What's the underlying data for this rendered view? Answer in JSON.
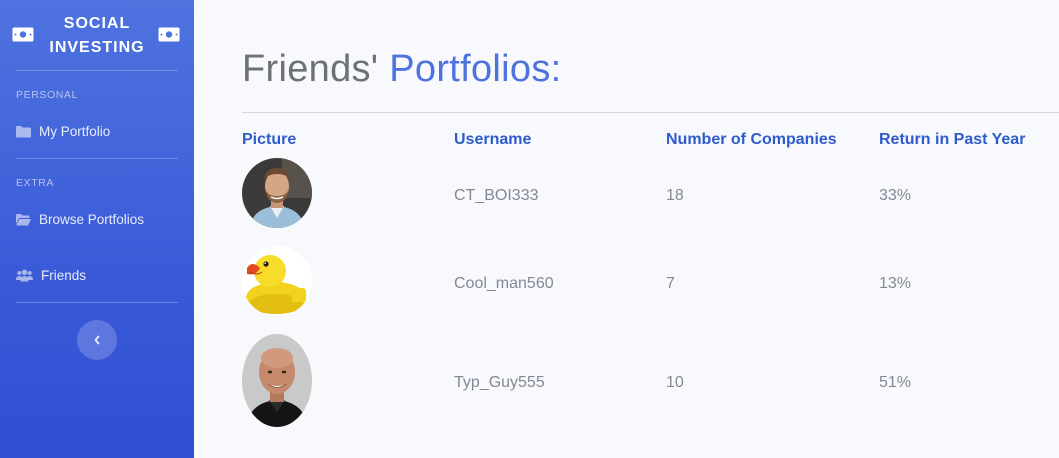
{
  "brand": {
    "title": "SOCIAL INVESTING",
    "icon": "money-bill-icon"
  },
  "sidebar": {
    "sections": [
      {
        "heading": "PERSONAL",
        "items": [
          {
            "label": "My Portfolio",
            "icon": "folder-icon"
          }
        ]
      },
      {
        "heading": "EXTRA",
        "items": [
          {
            "label": "Browse Portfolios",
            "icon": "folder-open-icon"
          },
          {
            "label": "Friends",
            "icon": "users-icon"
          }
        ]
      }
    ],
    "toggle_icon": "chevron-left-icon"
  },
  "page": {
    "title_plain": "Friends'",
    "title_accent": "Portfolios:"
  },
  "table": {
    "headers": [
      "Picture",
      "Username",
      "Number of Companies",
      "Return in Past Year"
    ],
    "rows": [
      {
        "picture": "bearded-man-avatar",
        "username": "CT_BOI333",
        "companies": "18",
        "return": "33%"
      },
      {
        "picture": "rubber-duck-avatar",
        "username": "Cool_man560",
        "companies": "7",
        "return": "13%"
      },
      {
        "picture": "bald-man-avatar",
        "username": "Typ_Guy555",
        "companies": "10",
        "return": "51%"
      }
    ]
  },
  "colors": {
    "accent": "#4e73df",
    "sidebar_bottom": "#2f4fd4",
    "header_text": "#2e5ccc",
    "cell_text": "#858796"
  }
}
